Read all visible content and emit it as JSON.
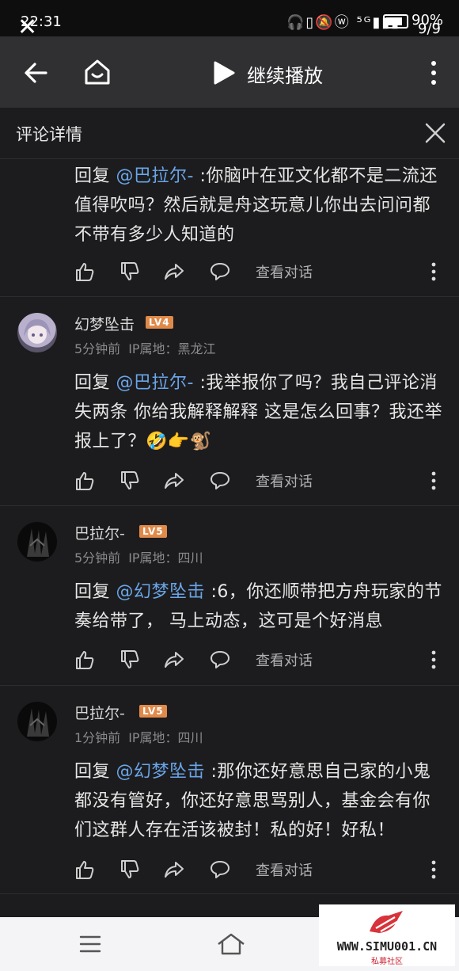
{
  "status_bar": {
    "time": "22:31",
    "battery": "90%",
    "page_counter": "9/9",
    "icons": "🎧▯🔕ⓦ ⁵ᴳ▮▮▮"
  },
  "nav": {
    "continue_label": "继续播放"
  },
  "detail": {
    "title": "评论详情"
  },
  "comments": [
    {
      "reply_prefix": "回复 ",
      "mention": "@巴拉尔-",
      "text": " :你脑叶在亚文化都不是二流还值得吹吗？然后就是舟这玩意儿你出去问问都不带有多少人知道的",
      "view_conversation": "查看对话"
    },
    {
      "username": "幻梦坠击",
      "level": "LV4",
      "time": "5分钟前",
      "ip": "IP属地：黑龙江",
      "reply_prefix": "回复 ",
      "mention": "@巴拉尔-",
      "text": " :我举报你了吗？我自己评论消失两条 你给我解释解释 这是怎么回事？我还举报上了？🤣👉🐒",
      "view_conversation": "查看对话"
    },
    {
      "username": "巴拉尔-",
      "level": "LV5",
      "time": "5分钟前",
      "ip": "IP属地：四川",
      "reply_prefix": "回复 ",
      "mention": "@幻梦坠击",
      "text": " :6，你还顺带把方舟玩家的节奏给带了， 马上动态，这可是个好消息",
      "view_conversation": "查看对话"
    },
    {
      "username": "巴拉尔-",
      "level": "LV5",
      "time": "1分钟前",
      "ip": "IP属地：四川",
      "reply_prefix": "回复 ",
      "mention": "@幻梦坠击",
      "text": " :那你还好意思自己家的小鬼都没有管好，你还好意思骂别人，基金会有你们这群人存在活该被封！私的好！好私！",
      "view_conversation": "查看对话"
    }
  ],
  "watermark": {
    "url": "WWW.SIMU001.CN",
    "sub": "私募社区"
  }
}
